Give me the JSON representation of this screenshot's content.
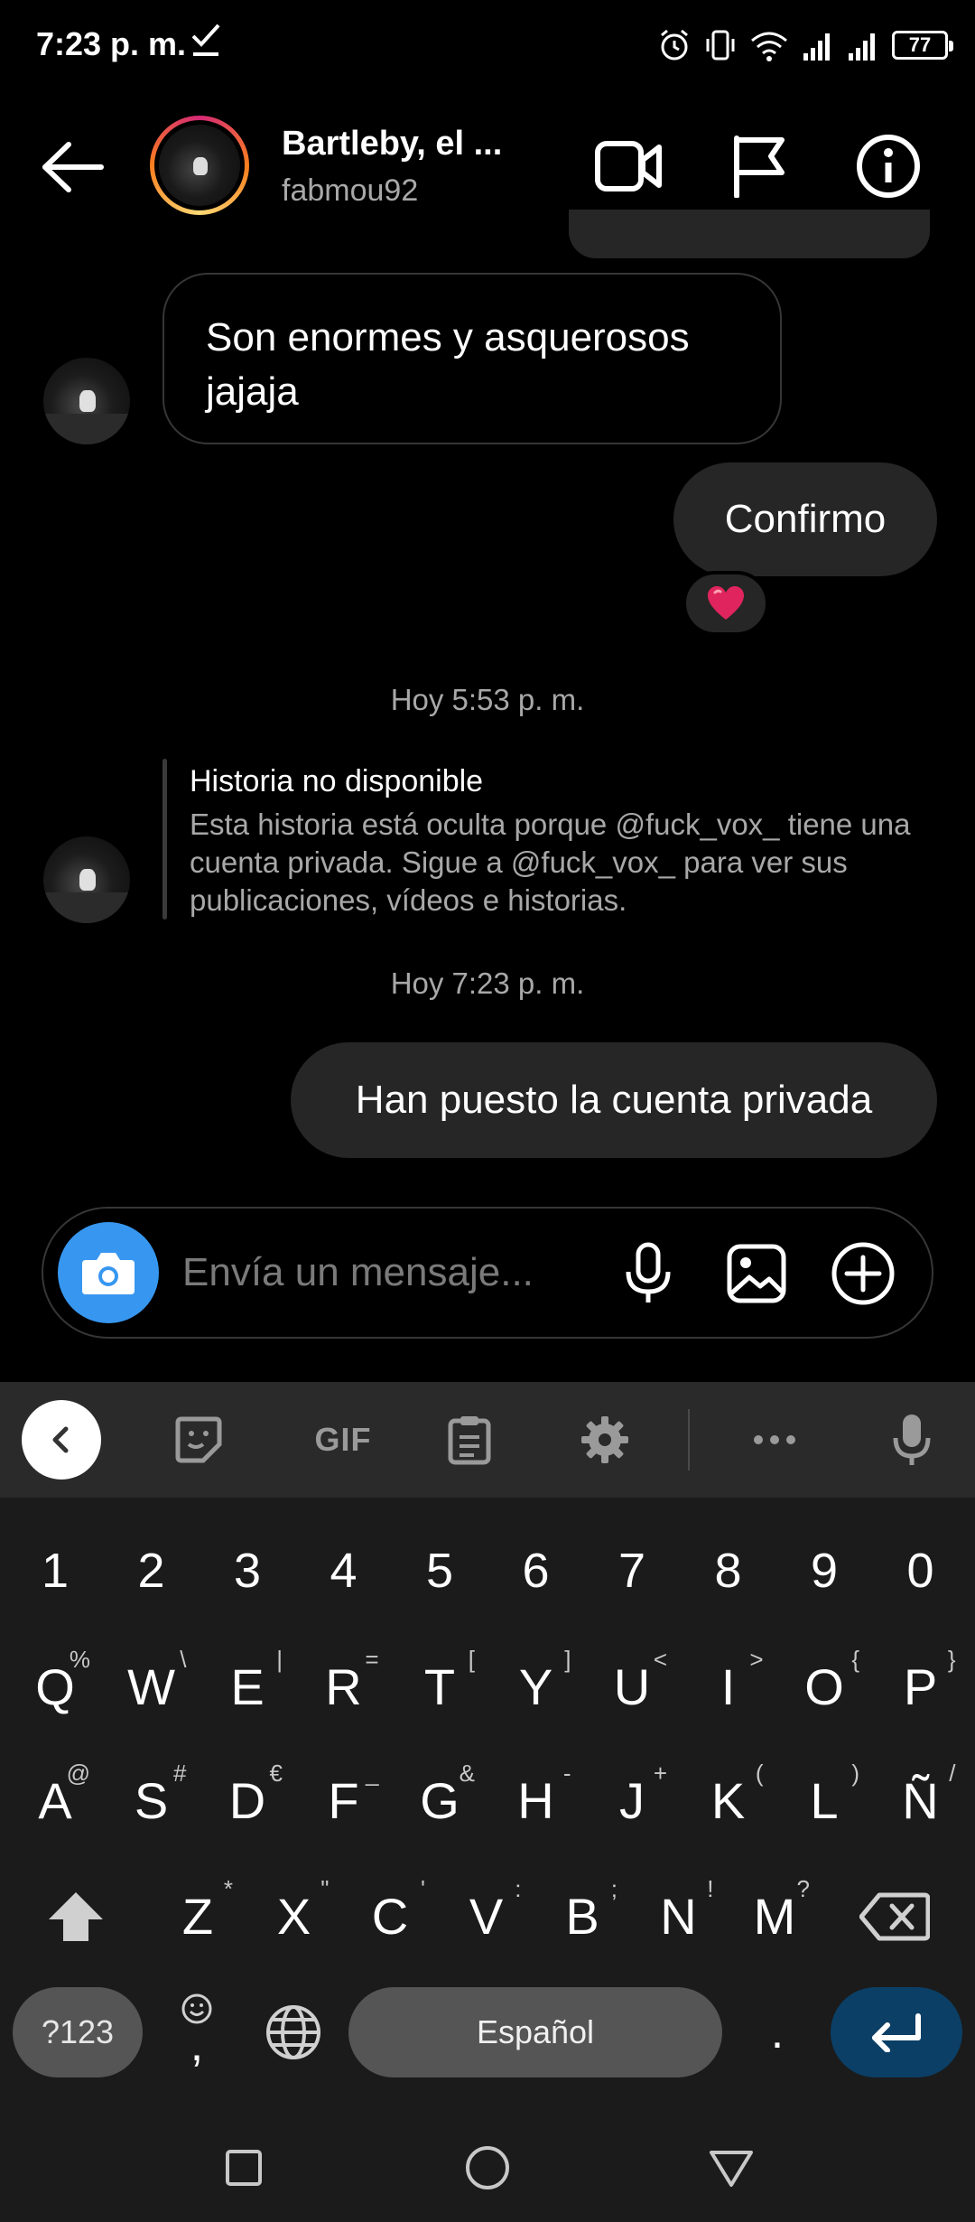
{
  "status_bar": {
    "time": "7:23 p. m.",
    "battery": "77"
  },
  "header": {
    "name": "Bartleby, el ...",
    "username": "fabmou92"
  },
  "messages": {
    "incoming_1": "Son enormes y asquerosos jajaja",
    "outgoing_1": "Confirmo",
    "reaction_1": "❤️",
    "timestamp_1": "Hoy 5:53 p. m.",
    "story": {
      "title": "Historia no disponible",
      "body": "Esta historia está oculta porque @fuck_vox_ tiene una cuenta privada. Sigue a @fuck_vox_ para ver sus publicaciones, vídeos e historias."
    },
    "timestamp_2": "Hoy 7:23 p. m.",
    "outgoing_2": "Han puesto la cuenta privada"
  },
  "composer": {
    "placeholder": "Envía un mensaje..."
  },
  "keyboard": {
    "toolbar_gif": "GIF",
    "numbers": [
      "1",
      "2",
      "3",
      "4",
      "5",
      "6",
      "7",
      "8",
      "9",
      "0"
    ],
    "row1": [
      {
        "k": "Q",
        "s": "%"
      },
      {
        "k": "W",
        "s": "\\"
      },
      {
        "k": "E",
        "s": "|"
      },
      {
        "k": "R",
        "s": "="
      },
      {
        "k": "T",
        "s": "["
      },
      {
        "k": "Y",
        "s": "]"
      },
      {
        "k": "U",
        "s": "<"
      },
      {
        "k": "I",
        "s": ">"
      },
      {
        "k": "O",
        "s": "{"
      },
      {
        "k": "P",
        "s": "}"
      }
    ],
    "row2": [
      {
        "k": "A",
        "s": "@"
      },
      {
        "k": "S",
        "s": "#"
      },
      {
        "k": "D",
        "s": "€"
      },
      {
        "k": "F",
        "s": "_"
      },
      {
        "k": "G",
        "s": "&"
      },
      {
        "k": "H",
        "s": "-"
      },
      {
        "k": "J",
        "s": "+"
      },
      {
        "k": "K",
        "s": "("
      },
      {
        "k": "L",
        "s": ")"
      },
      {
        "k": "Ñ",
        "s": "/"
      }
    ],
    "row3": [
      {
        "k": "Z",
        "s": "*"
      },
      {
        "k": "X",
        "s": "\""
      },
      {
        "k": "C",
        "s": "'"
      },
      {
        "k": "V",
        "s": ":"
      },
      {
        "k": "B",
        "s": ";"
      },
      {
        "k": "N",
        "s": "!"
      },
      {
        "k": "M",
        "s": "?"
      }
    ],
    "symbols_label": "?123",
    "emoji_comma": ",",
    "space_label": "Español",
    "period": "."
  },
  "colors": {
    "accent_blue": "#3797f0",
    "bubble": "#262626",
    "enter_key": "#0b3f66"
  }
}
